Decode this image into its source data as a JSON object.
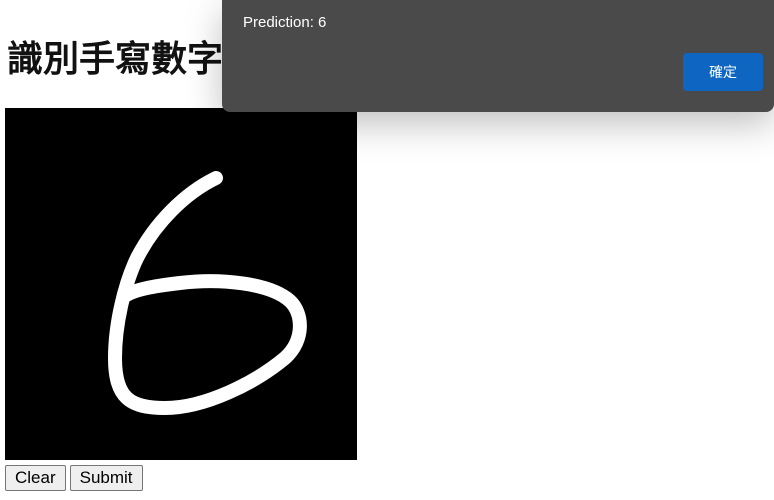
{
  "page": {
    "title": "識別手寫數字"
  },
  "canvas": {
    "background": "#000000",
    "stroke_color": "#ffffff",
    "drawn_digit": "6"
  },
  "controls": {
    "clear_label": "Clear",
    "submit_label": "Submit"
  },
  "dialog": {
    "message": "Prediction: 6",
    "ok_label": "確定",
    "accent": "#0e66c2"
  }
}
